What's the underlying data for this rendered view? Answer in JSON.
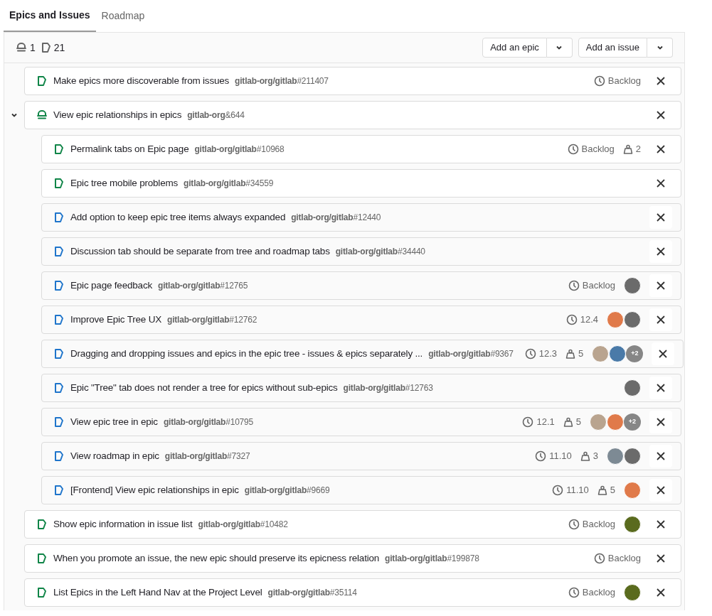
{
  "tabs": [
    {
      "label": "Epics and Issues",
      "selected": true
    },
    {
      "label": "Roadmap",
      "selected": false
    }
  ],
  "counts": {
    "epics": "1",
    "issues": "21"
  },
  "actions": [
    {
      "label": "Add an epic"
    },
    {
      "label": "Add an issue"
    }
  ],
  "items": [
    {
      "kind": "issue",
      "closed": false,
      "title": "Make epics more discoverable from issues",
      "reference": "**gitlab-org/gitlab**#211407",
      "milestone": "Backlog"
    },
    {
      "kind": "epic",
      "closed": false,
      "expanded": true,
      "title": "View epic relationships in epics",
      "reference": "**gitlab-org**&644",
      "children": [
        {
          "kind": "issue",
          "closed": false,
          "title": "Permalink tabs on Epic page",
          "reference": "**gitlab-org/gitlab**#10968",
          "milestone": "Backlog",
          "weight": "2"
        },
        {
          "kind": "issue",
          "closed": false,
          "title": "Epic tree mobile problems",
          "reference": "**gitlab-org/gitlab**#34559"
        },
        {
          "kind": "issue",
          "closed": true,
          "title": "Add option to keep epic tree items always expanded",
          "reference": "**gitlab-org/gitlab**#12440"
        },
        {
          "kind": "issue",
          "closed": true,
          "title": "Discussion tab should be separate from tree and roadmap tabs",
          "reference": "**gitlab-org/gitlab**#34440"
        },
        {
          "kind": "issue",
          "closed": true,
          "title": "Epic page feedback",
          "reference": "**gitlab-org/gitlab**#12765",
          "milestone": "Backlog",
          "avatars": [
            {
              "color": "#6b6b6b"
            }
          ]
        },
        {
          "kind": "issue",
          "closed": true,
          "title": "Improve Epic Tree UX",
          "reference": "**gitlab-org/gitlab**#12762",
          "milestone": "12.4",
          "avatars": [
            {
              "color": "#e07a4a"
            },
            {
              "color": "#6b6b6b"
            }
          ]
        },
        {
          "kind": "issue",
          "closed": true,
          "title": "Dragging and dropping issues and epics in the epic tree - issues & epics separately ...",
          "reference": "**gitlab-org/gitlab**#9367",
          "milestone": "12.3",
          "weight": "5",
          "avatars": [
            {
              "color": "#b9a48f"
            },
            {
              "color": "#4a7aa8"
            }
          ],
          "more": "+2"
        },
        {
          "kind": "issue",
          "closed": true,
          "title": "Epic \"Tree\" tab does not render a tree for epics without sub-epics",
          "reference": "**gitlab-org/gitlab**#12763",
          "avatars": [
            {
              "color": "#6b6b6b"
            }
          ]
        },
        {
          "kind": "issue",
          "closed": true,
          "title": "View epic tree in epic",
          "reference": "**gitlab-org/gitlab**#10795",
          "milestone": "12.1",
          "weight": "5",
          "avatars": [
            {
              "color": "#b9a48f"
            },
            {
              "color": "#e07a4a"
            }
          ],
          "more": "+2"
        },
        {
          "kind": "issue",
          "closed": true,
          "title": "View roadmap in epic",
          "reference": "**gitlab-org/gitlab**#7327",
          "milestone": "11.10",
          "weight": "3",
          "avatars": [
            {
              "color": "#7d8a94"
            },
            {
              "color": "#6b6b6b"
            }
          ]
        },
        {
          "kind": "issue",
          "closed": true,
          "title": "[Frontend] View epic relationships in epic",
          "reference": "**gitlab-org/gitlab**#9669",
          "milestone": "11.10",
          "weight": "5",
          "avatars": [
            {
              "color": "#e07a4a"
            }
          ]
        }
      ]
    },
    {
      "kind": "issue",
      "closed": false,
      "title": "Show epic information in issue list",
      "reference": "**gitlab-org/gitlab**#10482",
      "milestone": "Backlog",
      "avatars": [
        {
          "color": "#5a6b1e"
        }
      ]
    },
    {
      "kind": "issue",
      "closed": false,
      "title": "When you promote an issue, the new epic should preserve its epicness relation",
      "reference": "**gitlab-org/gitlab**#199878",
      "milestone": "Backlog"
    },
    {
      "kind": "issue",
      "closed": false,
      "title": "List Epics in the Left Hand Nav at the Project Level",
      "reference": "**gitlab-org/gitlab**#35114",
      "milestone": "Backlog",
      "avatars": [
        {
          "color": "#5a6b1e"
        }
      ]
    }
  ]
}
